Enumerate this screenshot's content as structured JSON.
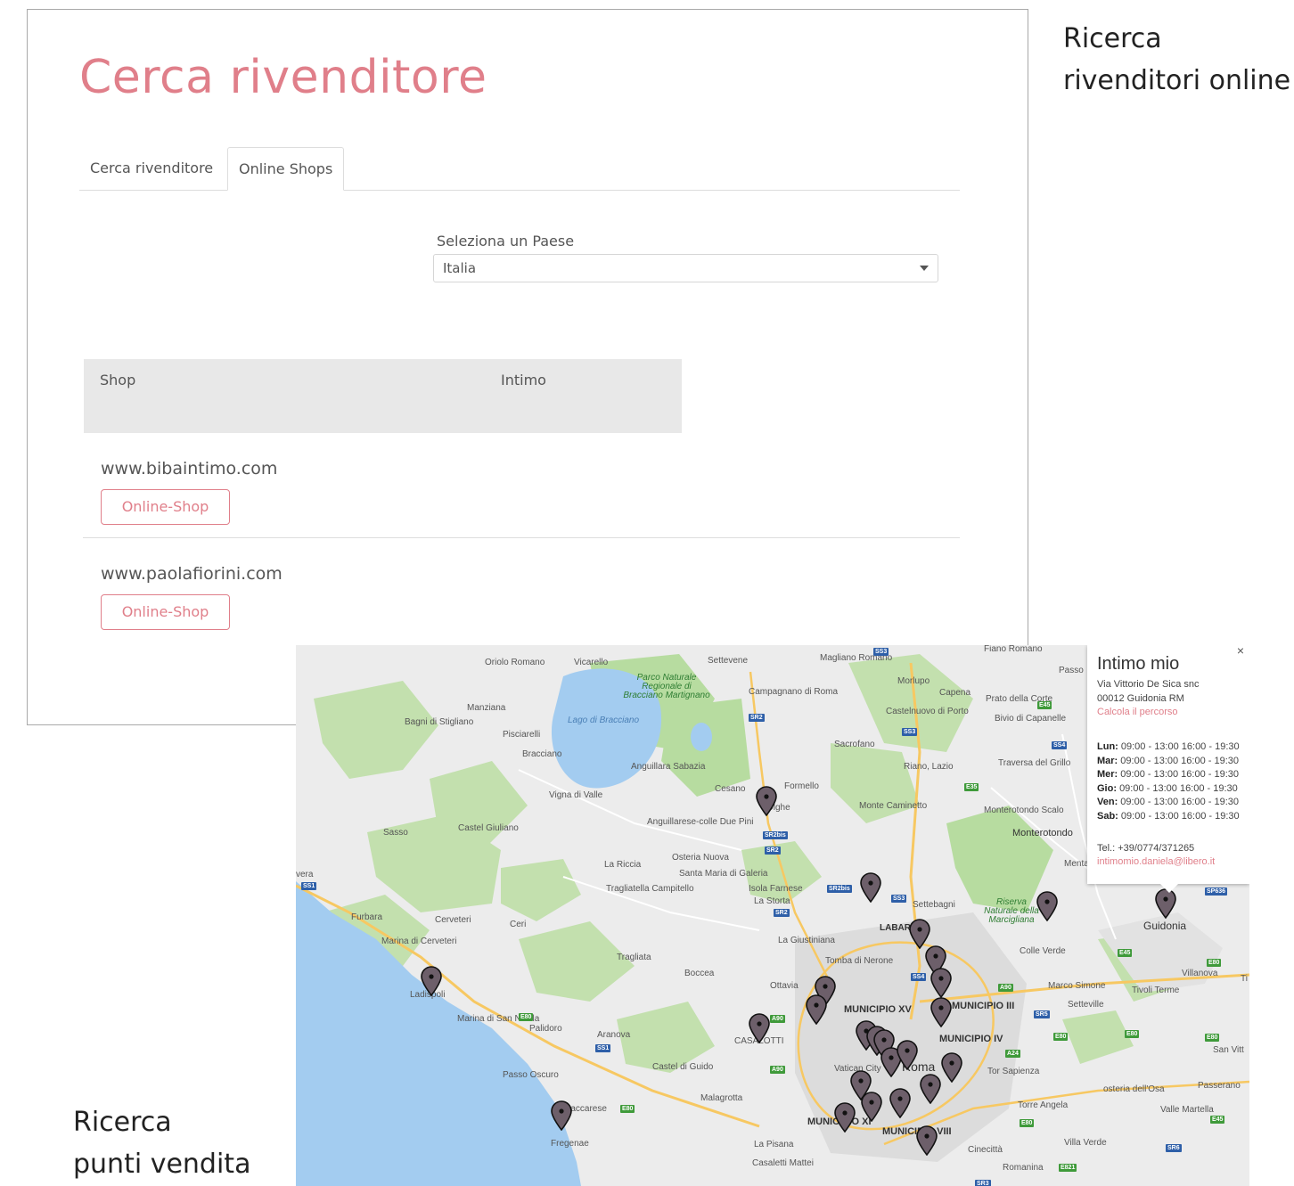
{
  "captions": {
    "top": [
      "Ricerca",
      "rivenditori online"
    ],
    "bottom": [
      "Ricerca",
      "punti vendita"
    ]
  },
  "page": {
    "title": "Cerca rivenditore",
    "tabs": [
      "Cerca rivenditore",
      "Online Shops"
    ],
    "country_label": "Seleziona un Paese",
    "country_value": "Italia",
    "table_headers": [
      "Shop",
      "Intimo"
    ],
    "shops": [
      {
        "site": "www.bibaintimo.com",
        "button": "Online-Shop"
      },
      {
        "site": "www.paolafiorini.com",
        "button": "Online-Shop"
      }
    ]
  },
  "map": {
    "labels": {
      "oriolo": "Oriolo Romano",
      "vicarello": "Vicarello",
      "settevene": "Settevene",
      "magliano": "Magliano Romano",
      "fiano": "Fiano Romano",
      "passo": "Passo",
      "parco": "Parco Naturale Regionale di Bracciano Martignano",
      "manziana": "Manziana",
      "lago": "Lago di Bracciano",
      "campagnano": "Campagnano di Roma",
      "morlupo": "Morlupo",
      "capena": "Capena",
      "prato": "Prato della Corte",
      "bivio": "Bivio di Capanelle",
      "castelnuovo": "Castelnuovo di Porto",
      "bagni": "Bagni di Stigliano",
      "pisciarelli": "Pisciarelli",
      "bracciano": "Bracciano",
      "anguillara": "Anguillara Sabazia",
      "sacrofano": "Sacrofano",
      "riano": "Riano, Lazio",
      "traversa": "Traversa del Grillo",
      "vigna": "Vigna di Valle",
      "cesano": "Cesano",
      "formello": "Formello",
      "olgiata": "Olghe",
      "monte": "Monte Caminetto",
      "monterotondo_scalo": "Monterotondo Scalo",
      "monterotondo": "Monterotondo",
      "anguillarese": "Anguillarese-colle Due Pini",
      "sasso": "Sasso",
      "castel_giuliano": "Castel Giuliano",
      "osteria": "Osteria Nuova",
      "mentana": "Mentana",
      "riccia": "La Riccia",
      "santa_maria": "Santa Maria di Galeria",
      "tragliatella": "Tragliatella Campitello",
      "isola": "Isola Farnese",
      "storta": "La Storta",
      "settebagni": "Settebagni",
      "riserva": "Riserva Naturale della Marcigliana",
      "guidonia": "Guidonia",
      "vera": "vera",
      "furbara": "Furbara",
      "cerveteri": "Cerveteri",
      "ceri": "Ceri",
      "labaro": "LABARO",
      "giustiniana": "La Giustiniana",
      "colle_verde": "Colle Verde",
      "marina_cerveteri": "Marina di Cerveteri",
      "tragliata": "Tragliata",
      "tomba": "Tomba di Nerone",
      "villanova": "Villanova",
      "boccea": "Boccea",
      "ottavia": "Ottavia",
      "ladispoli": "Ladispoli",
      "marco_simone": "Marco Simone",
      "tivoli": "Tivoli Terme",
      "municipio_xv": "MUNICIPIO XV",
      "municipio_iii": "MUNICIPIO III",
      "setteville": "Setteville",
      "marina_nicola": "Marina di San Nicola",
      "palidoro": "Palidoro",
      "aranova": "Aranova",
      "municipio_iv": "MUNICIPIO IV",
      "san_vitt": "San Vitt",
      "casalotti": "CASALOTTI",
      "vatican": "Vatican City",
      "roma": "Roma",
      "tor_sapienza": "Tor Sapienza",
      "castel_guido": "Castel di Guido",
      "passo_oscuro": "Passo Oscuro",
      "osteria_osa": "osteria dell'Osa",
      "passerano": "Passerano",
      "malagrotta": "Malagrotta",
      "maccarese": "Maccarese",
      "torre_angela": "Torre Angela",
      "valle_martella": "Valle Martella",
      "municipio_xi": "MUNICIPIO XI",
      "municipio_viii": "MUNICIPIO VIII",
      "fregenae": "Fregenae",
      "villa_verde": "Villa Verde",
      "pisana": "La Pisana",
      "cinecitta": "Cinecittà",
      "casaletti": "Casaletti Mattei",
      "romanina": "Romanina",
      "ti": "Ti"
    },
    "roads": [
      "SS3",
      "SR2",
      "SS3",
      "E45",
      "SS4",
      "E35",
      "SR2bis",
      "SR2",
      "SR2bis",
      "SS3",
      "SR2",
      "SS1",
      "SS4",
      "A90",
      "E80",
      "SS1",
      "A90",
      "A90",
      "SR5",
      "E80",
      "E80",
      "E80",
      "A24",
      "E80",
      "E80",
      "E45",
      "SR6",
      "E821",
      "SP636",
      "SR3",
      "E45",
      "E80"
    ],
    "popup": {
      "name": "Intimo mio",
      "close": "×",
      "address1": "Via Vittorio De Sica snc",
      "address2": "00012 Guidonia RM",
      "route_link": "Calcola il percorso",
      "hours": [
        {
          "day": "Lun:",
          "time": "09:00 - 13:00 16:00 - 19:30"
        },
        {
          "day": "Mar:",
          "time": "09:00 - 13:00 16:00 - 19:30"
        },
        {
          "day": "Mer:",
          "time": "09:00 - 13:00 16:00 - 19:30"
        },
        {
          "day": "Gio:",
          "time": "09:00 - 13:00 16:00 - 19:30"
        },
        {
          "day": "Ven:",
          "time": "09:00 - 13:00 16:00 - 19:30"
        },
        {
          "day": "Sab:",
          "time": "09:00 - 13:00 16:00 - 19:30"
        }
      ],
      "phone": "Tel.: +39/0774/371265",
      "email": "intimomio.daniela@libero.it"
    },
    "colors": {
      "water": "#a3ccf0",
      "park": "#b7dca0",
      "land": "#ececec",
      "pin": "#6d5f6a",
      "accent": "#e07f8a"
    }
  }
}
